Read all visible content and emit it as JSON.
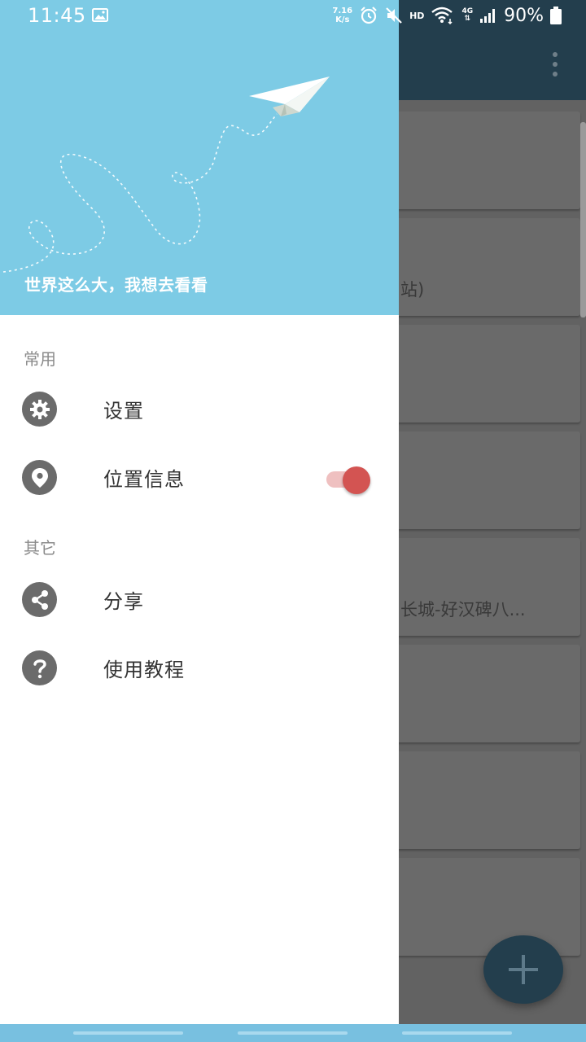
{
  "status_bar": {
    "time": "11:45",
    "net_speed_value": "7.16",
    "net_speed_unit": "K/s",
    "hd_label": "HD",
    "network_type": "4G",
    "battery": "90%"
  },
  "background": {
    "cards": [
      {
        "text": ""
      },
      {
        "text": "站)"
      },
      {
        "text": ""
      },
      {
        "text": ""
      },
      {
        "text": "长城-好汉碑八..."
      },
      {
        "text": ""
      },
      {
        "text": ""
      },
      {
        "text": ""
      }
    ]
  },
  "drawer": {
    "header_motto": "世界这么大，我想去看看",
    "sections": {
      "common": "常用",
      "other": "其它"
    },
    "items": {
      "settings": "设置",
      "location": "位置信息",
      "share": "分享",
      "tutorial": "使用教程"
    },
    "location_toggle_on": true
  },
  "colors": {
    "header_bg": "#7dcbe5",
    "toolbar": "#233e4d",
    "toggle_thumb": "#d35452",
    "icon_gray": "#6b6b6b"
  }
}
